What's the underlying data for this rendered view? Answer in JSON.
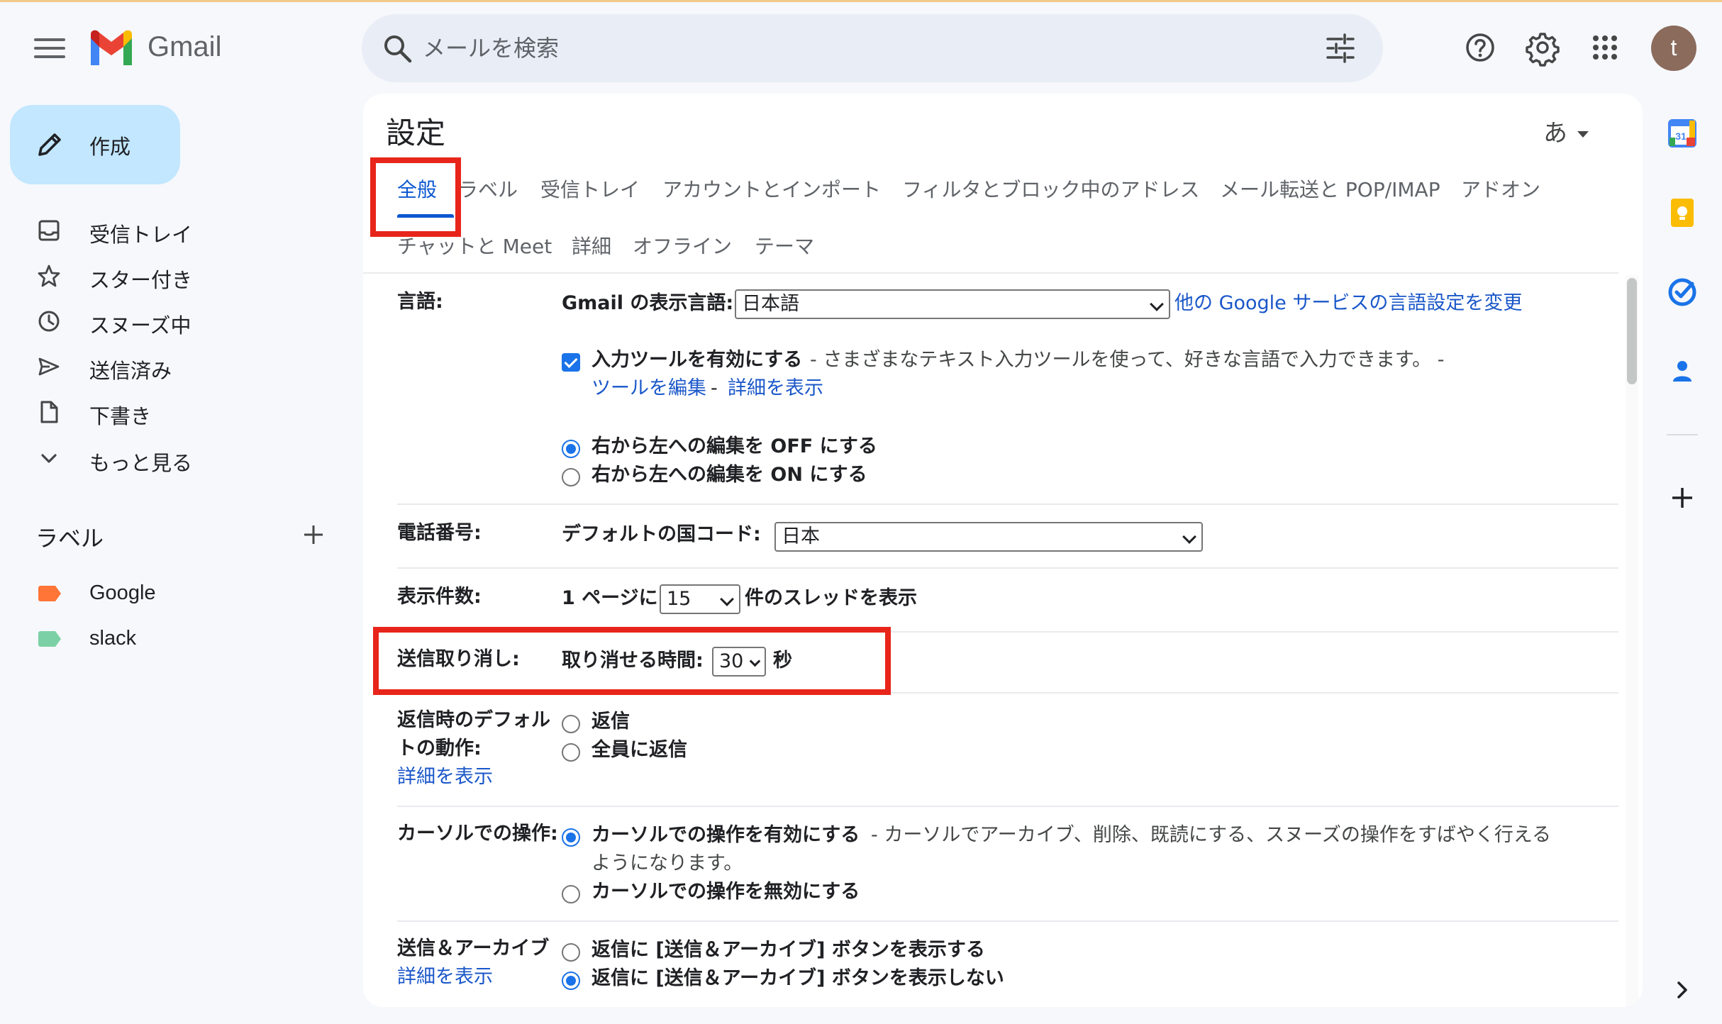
{
  "app": {
    "name": "Gmail",
    "avatar_letter": "t"
  },
  "search": {
    "placeholder": "メールを検索"
  },
  "sidebar": {
    "compose_label": "作成",
    "items": [
      {
        "label": "受信トレイ",
        "icon": "inbox-icon"
      },
      {
        "label": "スター付き",
        "icon": "star-icon"
      },
      {
        "label": "スヌーズ中",
        "icon": "clock-icon"
      },
      {
        "label": "送信済み",
        "icon": "send-icon"
      },
      {
        "label": "下書き",
        "icon": "draft-icon"
      },
      {
        "label": "もっと見る",
        "icon": "chevron-down-icon"
      }
    ],
    "labels_heading": "ラベル",
    "labels": [
      {
        "label": "Google",
        "color": "#ff7537"
      },
      {
        "label": "slack",
        "color": "#7bd1a5"
      }
    ]
  },
  "settings": {
    "title": "設定",
    "ime_label": "あ",
    "tabs": [
      "全般",
      "ラベル",
      "受信トレイ",
      "アカウントとインポート",
      "フィルタとブロック中のアドレス",
      "メール転送と POP/IMAP",
      "アドオン",
      "チャットと Meet",
      "詳細",
      "オフライン",
      "テーマ"
    ],
    "language": {
      "label": "言語:",
      "display_label": "Gmail の表示言語:",
      "display_value": "日本語",
      "other_link": "他の Google サービスの言語設定を変更",
      "input_tools_checked": true,
      "input_tools_label": "入力ツールを有効にする",
      "input_tools_desc": " - さまざまなテキスト入力ツールを使って、好きな言語で入力できます。 -",
      "edit_tools_link": "ツールを編集",
      "sep": " - ",
      "details_link": "詳細を表示",
      "rtl_off": "右から左への編集を OFF にする",
      "rtl_on": "右から左への編集を ON にする",
      "rtl_selected": "off"
    },
    "phone": {
      "label": "電話番号:",
      "country_label": "デフォルトの国コード:",
      "country_value": "日本"
    },
    "page_size": {
      "label": "表示件数:",
      "prefix": "1 ページに",
      "value": "15",
      "suffix": "件のスレッドを表示"
    },
    "undo_send": {
      "label": "送信取り消し:",
      "period_label": "取り消せる時間:",
      "value": "30",
      "unit": "秒"
    },
    "reply_default": {
      "label_line1": "返信時のデフォル",
      "label_line2": "トの動作:",
      "details_link": "詳細を表示",
      "opt_reply": "返信",
      "opt_reply_all": "全員に返信"
    },
    "hover_actions": {
      "label": "カーソルでの操作:",
      "enable_label": "カーソルでの操作を有効にする",
      "enable_desc": " - カーソルでアーカイブ、削除、既読にする、スヌーズの操作をすばやく行える",
      "enable_desc2": "ようになります。",
      "disable_label": "カーソルでの操作を無効にする",
      "selected": "enable"
    },
    "send_archive": {
      "label": "送信＆アーカイブ",
      "details_link": "詳細を表示",
      "show_label": "返信に [送信＆アーカイブ] ボタンを表示する",
      "hide_label": "返信に [送信＆アーカイブ] ボタンを表示しない",
      "selected": "hide"
    }
  },
  "highlight_color": "#e8251a"
}
